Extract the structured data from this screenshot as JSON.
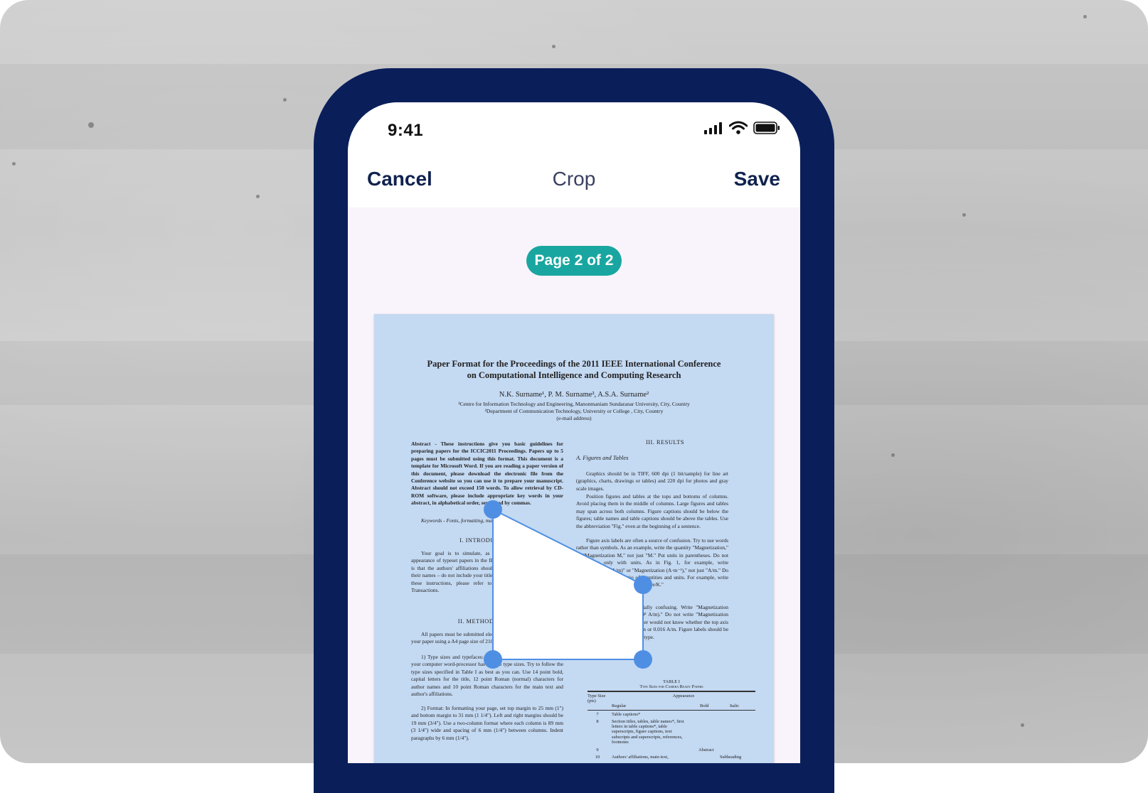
{
  "status_bar": {
    "time": "9:41",
    "icons": [
      "signal-icon",
      "wifi-icon",
      "battery-icon"
    ]
  },
  "nav": {
    "cancel_label": "Cancel",
    "title": "Crop",
    "save_label": "Save"
  },
  "page_indicator": "Page 2 of 2",
  "colors": {
    "frame": "#0a1f5a",
    "pill": "#1aa6a0",
    "crop_handle": "#4f8fe3",
    "document_tint": "#c4d9f2"
  },
  "document": {
    "title_line1": "Paper Format for the Proceedings of the 2011 IEEE International Conference",
    "title_line2": "on Computational Intelligence and Computing Research",
    "authors": "N.K. Surname¹, P. M. Surname², A.S.A. Surname²",
    "affil1": "¹Centre for Information Technology and Engineering, Manonmaniam Sundaranar University, City, Country",
    "affil2": "²Department of Communication Technology, University or College , City, Country",
    "affil3": "(e-mail address)",
    "abstract": "Abstract - These instructions give you basic guidelines for preparing papers for the ICCIC2011 Proceedings. Papers up to 5 pages must be submitted using this format. This document is a template for Microsoft Word. If you are reading a paper version of this document, please download the electronic file from the Conference website so you can use it to prepare your manuscript. Abstract should not exceed 150 words. To allow retrieval by CD-ROM software, please include appropriate key words in your abstract, in alphabetical order, separated by commas.",
    "keywords": "Keywords - Fonts, formatting, margins",
    "intro_head": "I. INTRODUCTION",
    "intro_text": "Your goal is to simulate, as closely as possible, the usual appearance of typeset papers in the IEEE Transactions. One difference is that the authors' affiliations should appear immediately following their names – do not include your title there. For items not addressed in these instructions, please refer to a recent issue of an IEEE Transactions.",
    "method_head": "II. METHODOLOGY",
    "method_text1": "All papers must be submitted electronically in pdf format. Prepare your paper using a A4 page size of 210 mm × 297 mm (8.27\" × 11.69\").",
    "method_text2": "1) Type sizes and typefaces: The best results will be obtained if your computer word-processor has several type sizes. Try to follow the type sizes specified in Table I as best as you can. Use 14 point bold, capital letters for the title, 12 point Roman (normal) characters for author names and 10 point Roman characters for the main text and author's affiliations.",
    "method_text3": "2) Format: In formatting your page, set top margin to 25 mm (1\") and bottom margin to 31 mm (1 1/4\"). Left and right margins should be 19 mm (3/4\"). Use a two-column format where each column is 89 mm (3 1/4\") wide and spacing of 6 mm (1/4\") between columns. Indent paragraphs by 6 mm (1/4\").",
    "results_head": "III. RESULTS",
    "figures_head": "A. Figures and Tables",
    "results_text1": "Graphics should be in TIFF, 600 dpi (1 bit/sample) for line art (graphics, charts, drawings or tables) and 220 dpi for photos and gray scale images.",
    "results_text2": "Position figures and tables at the tops and bottoms of columns. Avoid placing them in the middle of columns. Large figures and tables may span across both columns. Figure captions should be below the figures; table names and table captions should be above the tables. Use the abbreviation \"Fig.\" even at the beginning of a sentence.",
    "results_text3": "Figure axis labels are often a source of confusion. Try to use words rather than symbols. As an example, write the quantity \"Magnetization,\" or \"Magnetization M,\" not just \"M.\" Put units in parentheses. Do not label axes only with units. As in Fig. 1, for example, write \"Magnetization (A/m)\" or \"Magnetization (A·m⁻¹),\" not just \"A/m.\" Do not label axes with a ratio of quantities and units. For example, write \"Temperature (K),\" not \"Temperature/K.\"",
    "results_text4": "Multipliers can be especially confusing. Write \"Magnetization (kA/m)\" or \"Magnetization (10³ A/m).\" Do not write \"Magnetization (A/m) × 1000\" because the reader would not know whether the top axis label in Fig. 1 meant 16000 A/m or 0.016 A/m. Figure labels should be legible, approximately 10-point type.",
    "table_label": "TABLE I",
    "table_caption": "Type Sizes for Camera Ready Papers",
    "table_headers": [
      "Type Size (pts)",
      "Appearance",
      "Regular",
      "Bold",
      "Italic"
    ],
    "table_rows": [
      [
        "7",
        "Table captions*",
        "",
        ""
      ],
      [
        "8",
        "Section titles, tables, table names*, first letters in table captions*, table superscripts, figure captions, text subscripts and superscripts, references, footnotes",
        "",
        ""
      ],
      [
        "9",
        "",
        "Abstract",
        ""
      ],
      [
        "10",
        "Authors' affiliations, main text,",
        "",
        "Subheading"
      ]
    ]
  }
}
